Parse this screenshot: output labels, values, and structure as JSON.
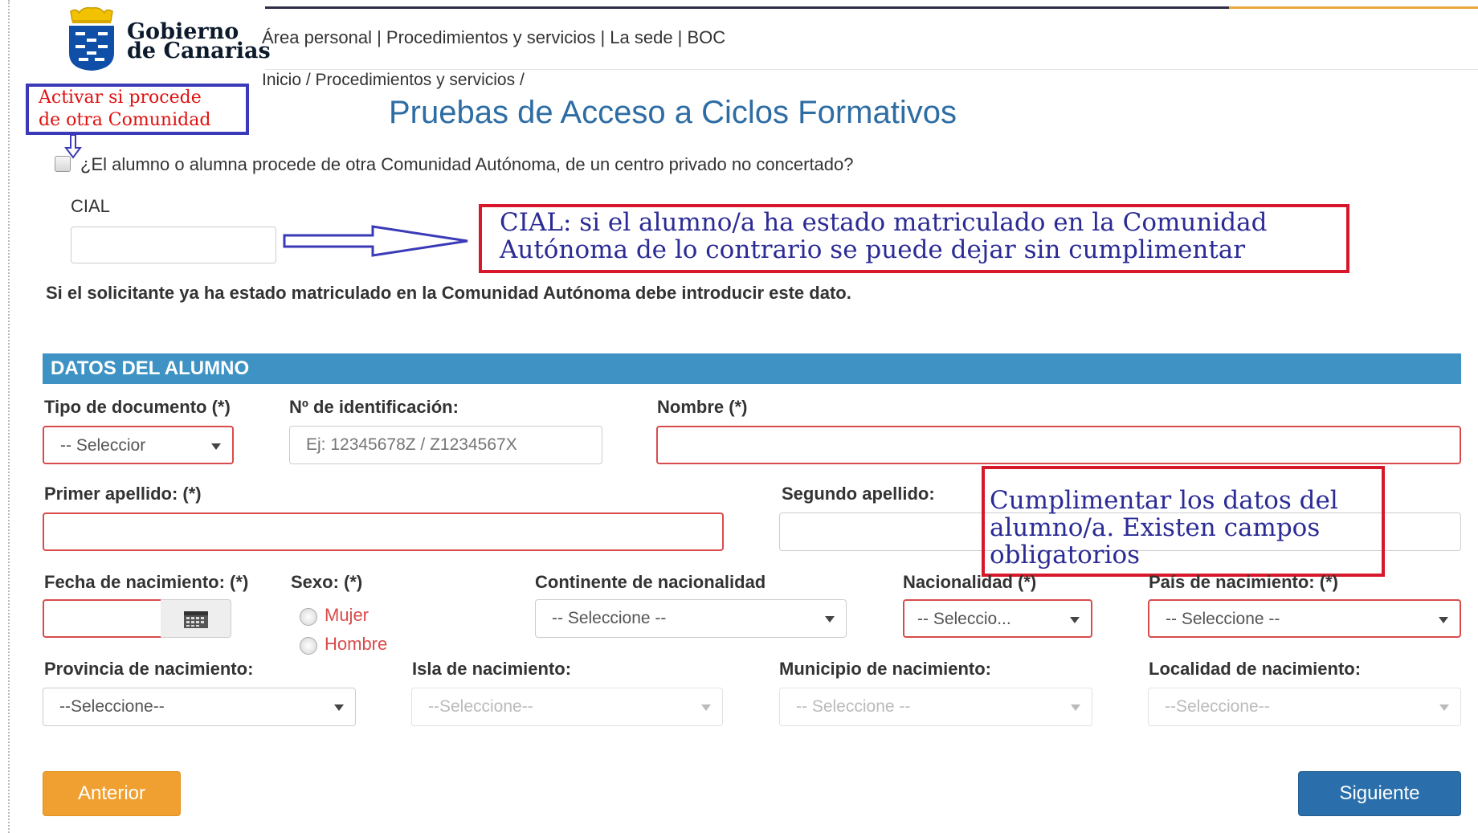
{
  "header": {
    "logo_line1": "Gobierno",
    "logo_line2": "de Canarias",
    "nav": "Área personal | Procedimientos y servicios | La sede | BOC"
  },
  "breadcrumb": "Inicio / Procedimientos y servicios /",
  "page_title": "Pruebas de Acceso a Ciclos Formativos",
  "annotations": {
    "activar_line1": "Activar si procede",
    "activar_line2": "de otra Comunidad",
    "cial_line1": "CIAL: si el alumno/a ha estado matriculado en la Comunidad",
    "cial_line2": "Autónoma de lo contrario se puede dejar sin cumplimentar",
    "datos_line1": "Cumplimentar los datos del",
    "datos_line2": "alumno/a. Existen campos",
    "datos_line3": "obligatorios"
  },
  "otra_comunidad": {
    "label": "¿El alumno o alumna procede de otra Comunidad Autónoma, de un centro privado no concertado?",
    "checked": false
  },
  "cial": {
    "label": "CIAL",
    "value": "",
    "help": "Si el solicitante ya ha estado matriculado en la Comunidad Autónoma debe introducir este dato."
  },
  "section_title": "DATOS DEL ALUMNO",
  "form": {
    "tipo_documento": {
      "label": "Tipo de documento (*)",
      "value": "-- Seleccior"
    },
    "num_identificacion": {
      "label": "Nº de identificación:",
      "placeholder": "Ej: 12345678Z / Z1234567X"
    },
    "nombre": {
      "label": "Nombre (*)",
      "value": ""
    },
    "primer_apellido": {
      "label": "Primer apellido: (*)",
      "value": ""
    },
    "segundo_apellido": {
      "label": "Segundo apellido:",
      "value": ""
    },
    "fecha_nacimiento": {
      "label": "Fecha de nacimiento: (*)",
      "value": ""
    },
    "sexo": {
      "label": "Sexo: (*)",
      "options": [
        "Mujer",
        "Hombre"
      ]
    },
    "continente": {
      "label": "Continente de nacionalidad",
      "value": "-- Seleccione --"
    },
    "nacionalidad": {
      "label": "Nacionalidad (*)",
      "value": "-- Seleccio..."
    },
    "pais_nacimiento": {
      "label": "País de nacimiento: (*)",
      "value": "-- Seleccione --"
    },
    "provincia": {
      "label": "Provincia de nacimiento:",
      "value": "--Seleccione--"
    },
    "isla": {
      "label": "Isla de nacimiento:",
      "value": "--Seleccione--"
    },
    "municipio": {
      "label": "Municipio de nacimiento:",
      "value": "-- Seleccione --"
    },
    "localidad": {
      "label": "Localidad de nacimiento:",
      "value": "--Seleccione--"
    }
  },
  "buttons": {
    "anterior": "Anterior",
    "siguiente": "Siguiente"
  },
  "colors": {
    "title_blue": "#2e6da4",
    "section_blue": "#3e93c4",
    "required_red": "#d94b4b",
    "anterior_orange": "#f0a030",
    "siguiente_blue": "#2a6fab",
    "annotation_red": "#d8182a",
    "annotation_blue": "#3a3ab8"
  }
}
